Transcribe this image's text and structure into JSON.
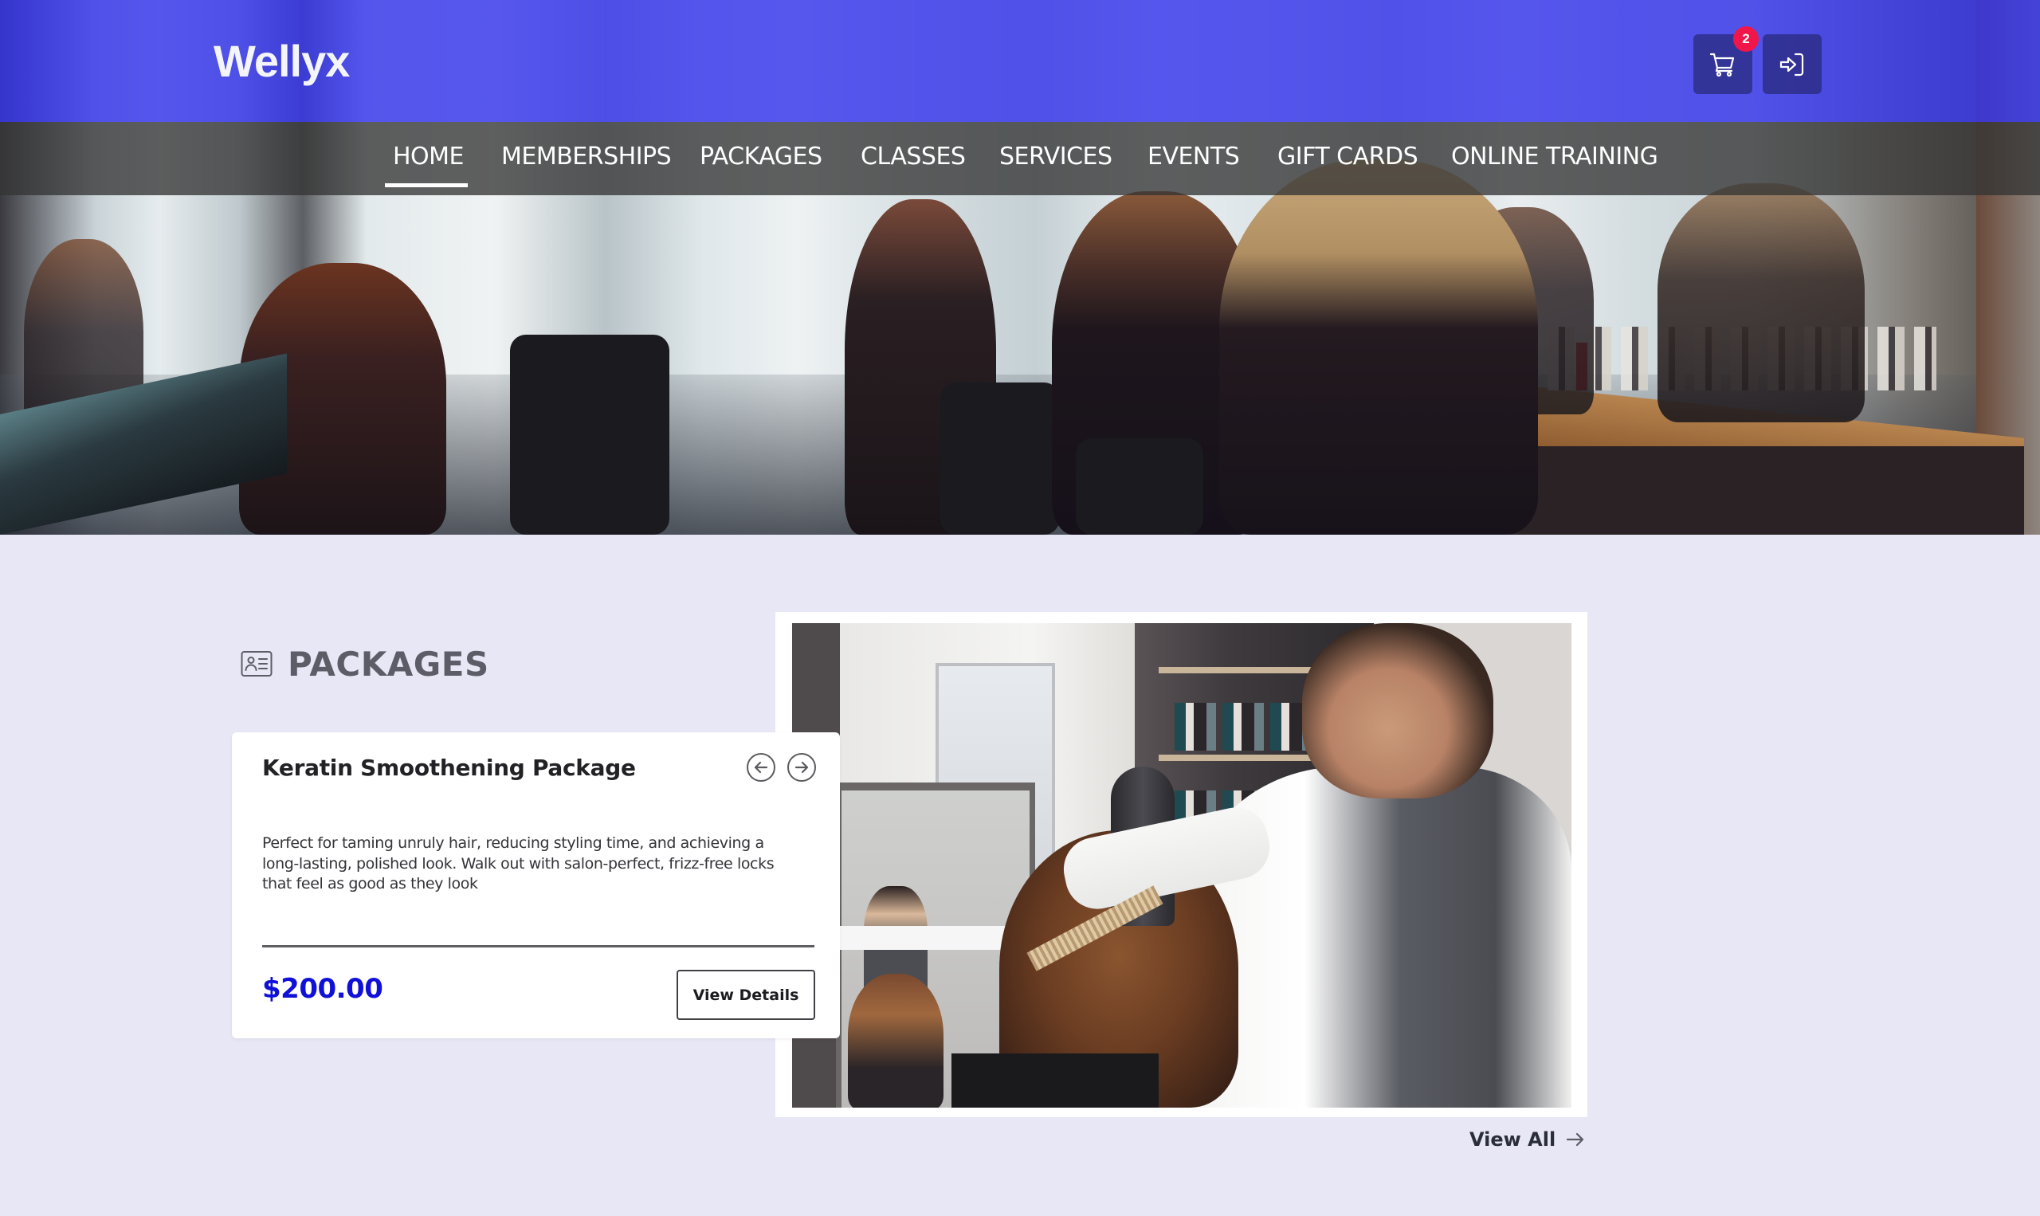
{
  "header": {
    "logo": "Wellyx",
    "cart": {
      "icon": "cart-icon",
      "badge_count": "2"
    },
    "login": {
      "icon": "login-icon"
    },
    "overlay_color": "#3434eb"
  },
  "nav": {
    "items": [
      {
        "label": "HOME",
        "active": true
      },
      {
        "label": "MEMBERSHIPS",
        "active": false
      },
      {
        "label": "PACKAGES",
        "active": false
      },
      {
        "label": "CLASSES",
        "active": false
      },
      {
        "label": "SERVICES",
        "active": false
      },
      {
        "label": "EVENTS",
        "active": false
      },
      {
        "label": "GIFT CARDS",
        "active": false
      },
      {
        "label": "ONLINE TRAINING",
        "active": false
      }
    ]
  },
  "hero": {
    "image": "salon-interior-photo"
  },
  "packages_section": {
    "heading": "PACKAGES",
    "heading_icon": "id-card-icon",
    "card": {
      "title": "Keratin Smoothening Package",
      "description": "Perfect for taming unruly hair, reducing styling time, and achieving a long-lasting, polished look. Walk out with salon-perfect, frizz-free locks that feel as good as they look",
      "price": "$200.00",
      "view_details_label": "View Details",
      "prev_icon": "arrow-left-circle-icon",
      "next_icon": "arrow-right-circle-icon"
    },
    "image": "hairdresser-blow-drying-photo",
    "view_all_label": "View All"
  },
  "colors": {
    "page_background": "#e7e7f5",
    "price": "#1010d8",
    "badge": "#f0164a",
    "heading": "#5d5d68"
  }
}
